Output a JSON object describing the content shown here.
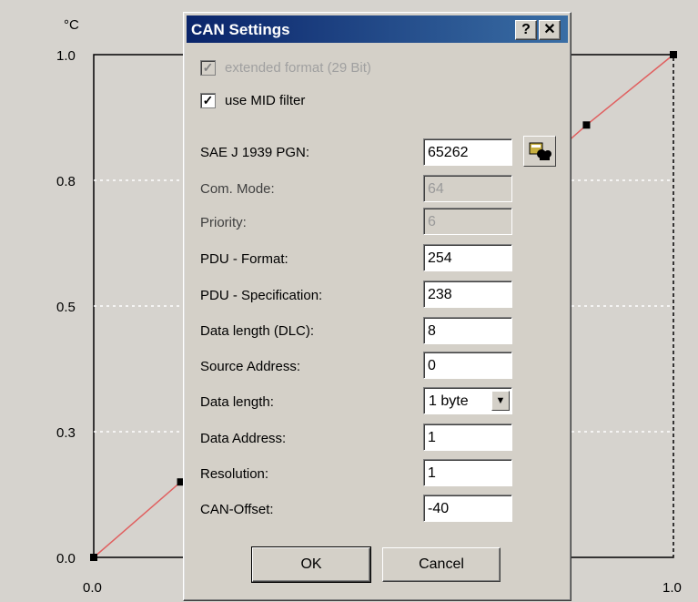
{
  "chart_data": {
    "type": "line",
    "unit_label": "°C",
    "y_ticks": [
      "1.0",
      "0.8",
      "0.5",
      "0.3",
      "0.0"
    ],
    "x_ticks": [
      "0.0",
      "1.0"
    ],
    "xlim": [
      0,
      1
    ],
    "ylim": [
      0,
      1
    ],
    "series": [
      {
        "x": [
          0.0,
          0.15,
          0.85,
          1.0
        ],
        "y": [
          0.0,
          0.15,
          0.86,
          1.0
        ]
      }
    ],
    "line_color": "#e06060",
    "grid": true
  },
  "dialog": {
    "title": "CAN Settings",
    "help_label": "?",
    "close_label": "✕",
    "extended_format": {
      "label": "extended format (29 Bit)",
      "checked": true,
      "enabled": false
    },
    "mid_filter": {
      "label": "use MID filter",
      "checked": true
    },
    "fields": {
      "pgn": {
        "label": "SAE J 1939 PGN:",
        "value": "65262"
      },
      "com_mode": {
        "label": "Com. Mode:",
        "value": "64"
      },
      "priority": {
        "label": "Priority:",
        "value": "6"
      },
      "pdu_format": {
        "label": "PDU - Format:",
        "value": "254"
      },
      "pdu_spec": {
        "label": "PDU - Specification:",
        "value": "238"
      },
      "dlc": {
        "label": "Data length (DLC):",
        "value": "8"
      },
      "source_address": {
        "label": "Source Address:",
        "value": "0"
      },
      "data_length": {
        "label": "Data length:",
        "value": "1 byte"
      },
      "data_address": {
        "label": "Data Address:",
        "value": "1"
      },
      "resolution": {
        "label": "Resolution:",
        "value": "1"
      },
      "can_offset": {
        "label": "CAN-Offset:",
        "value": "-40"
      }
    },
    "ok_label": "OK",
    "cancel_label": "Cancel",
    "search_icon": "search-database-icon"
  }
}
